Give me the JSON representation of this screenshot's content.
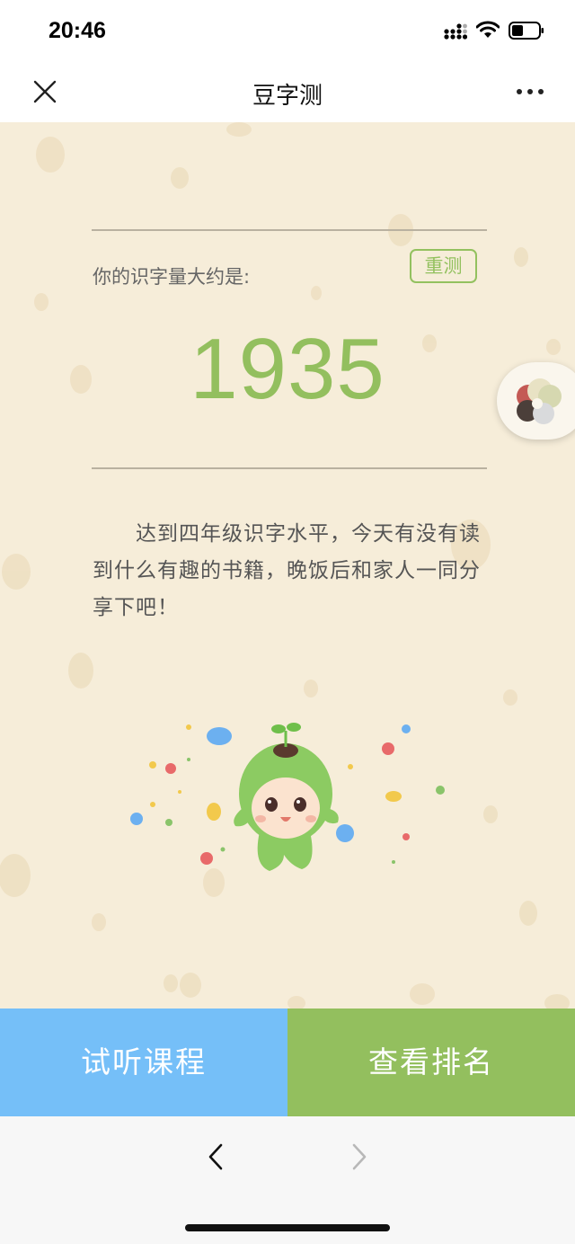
{
  "status_bar": {
    "time": "20:46"
  },
  "nav": {
    "title": "豆字测"
  },
  "result": {
    "label": "你的识字量大约是:",
    "retest_label": "重测",
    "count": "1935",
    "description": "达到四年级识字水平，今天有没有读到什么有趣的书籍，晚饭后和家人一同分享下吧！"
  },
  "actions": {
    "trial_label": "试听课程",
    "ranking_label": "查看排名"
  },
  "colors": {
    "accent_green": "#93bf5e",
    "accent_blue": "#75bff8",
    "background": "#f6edd9"
  },
  "icons": [
    "close-icon",
    "more-icon",
    "back-icon",
    "forward-icon",
    "signal-icon",
    "wifi-icon",
    "battery-icon"
  ]
}
